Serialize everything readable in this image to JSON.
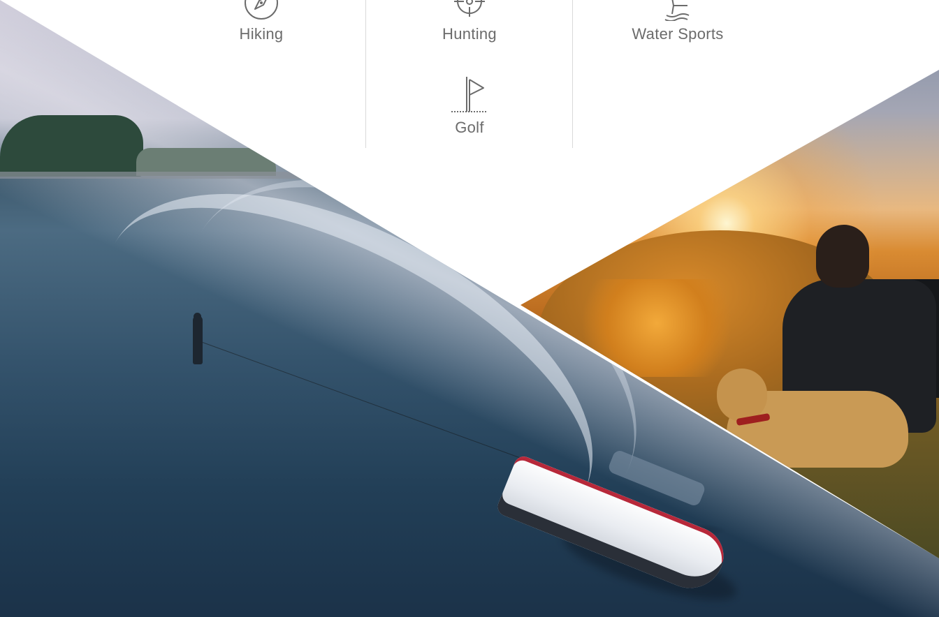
{
  "activities": [
    {
      "label": "Hiking",
      "icon": "compass-icon"
    },
    {
      "label": "Hunting",
      "icon": "crosshair-icon"
    },
    {
      "label": "Water Sports",
      "icon": "water-skier-icon"
    },
    {
      "label": "Golf",
      "icon": "golf-flag-icon"
    }
  ],
  "colors": {
    "label_text": "#6b6b6b",
    "icon_stroke": "#6b6b6b",
    "divider": "#d9d9d9",
    "background": "#ffffff"
  },
  "images": [
    {
      "name": "water-skiing-photo",
      "alt": "boat towing a water skier on a lake"
    },
    {
      "name": "hiking-sunset-photo",
      "alt": "man with backpack and dog overlooking hills at sunset"
    }
  ]
}
